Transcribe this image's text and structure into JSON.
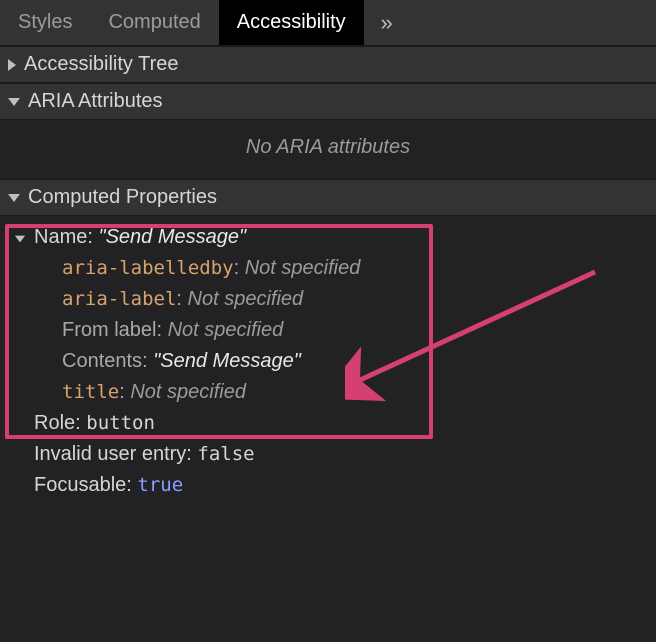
{
  "tabs": {
    "list": [
      {
        "label": "Styles",
        "active": false
      },
      {
        "label": "Computed",
        "active": false
      },
      {
        "label": "Accessibility",
        "active": true
      }
    ],
    "overflow": "»"
  },
  "sections": {
    "tree": {
      "label": "Accessibility Tree"
    },
    "aria": {
      "label": "ARIA Attributes",
      "empty_text": "No ARIA attributes"
    },
    "computed": {
      "label": "Computed Properties"
    }
  },
  "computed": {
    "name_label": "Name:",
    "name_value": "\"Send Message\"",
    "sources": {
      "aria_labelledby": {
        "key": "aria-labelledby",
        "value": "Not specified"
      },
      "aria_label": {
        "key": "aria-label",
        "value": "Not specified"
      },
      "from_label": {
        "key": "From label",
        "value": "Not specified"
      },
      "contents": {
        "key": "Contents",
        "value": "\"Send Message\""
      },
      "title": {
        "key": "title",
        "value": "Not specified"
      }
    },
    "role": {
      "key": "Role",
      "value": "button"
    },
    "invalid": {
      "key": "Invalid user entry",
      "value": "false"
    },
    "focusable": {
      "key": "Focusable",
      "value": "true"
    }
  }
}
